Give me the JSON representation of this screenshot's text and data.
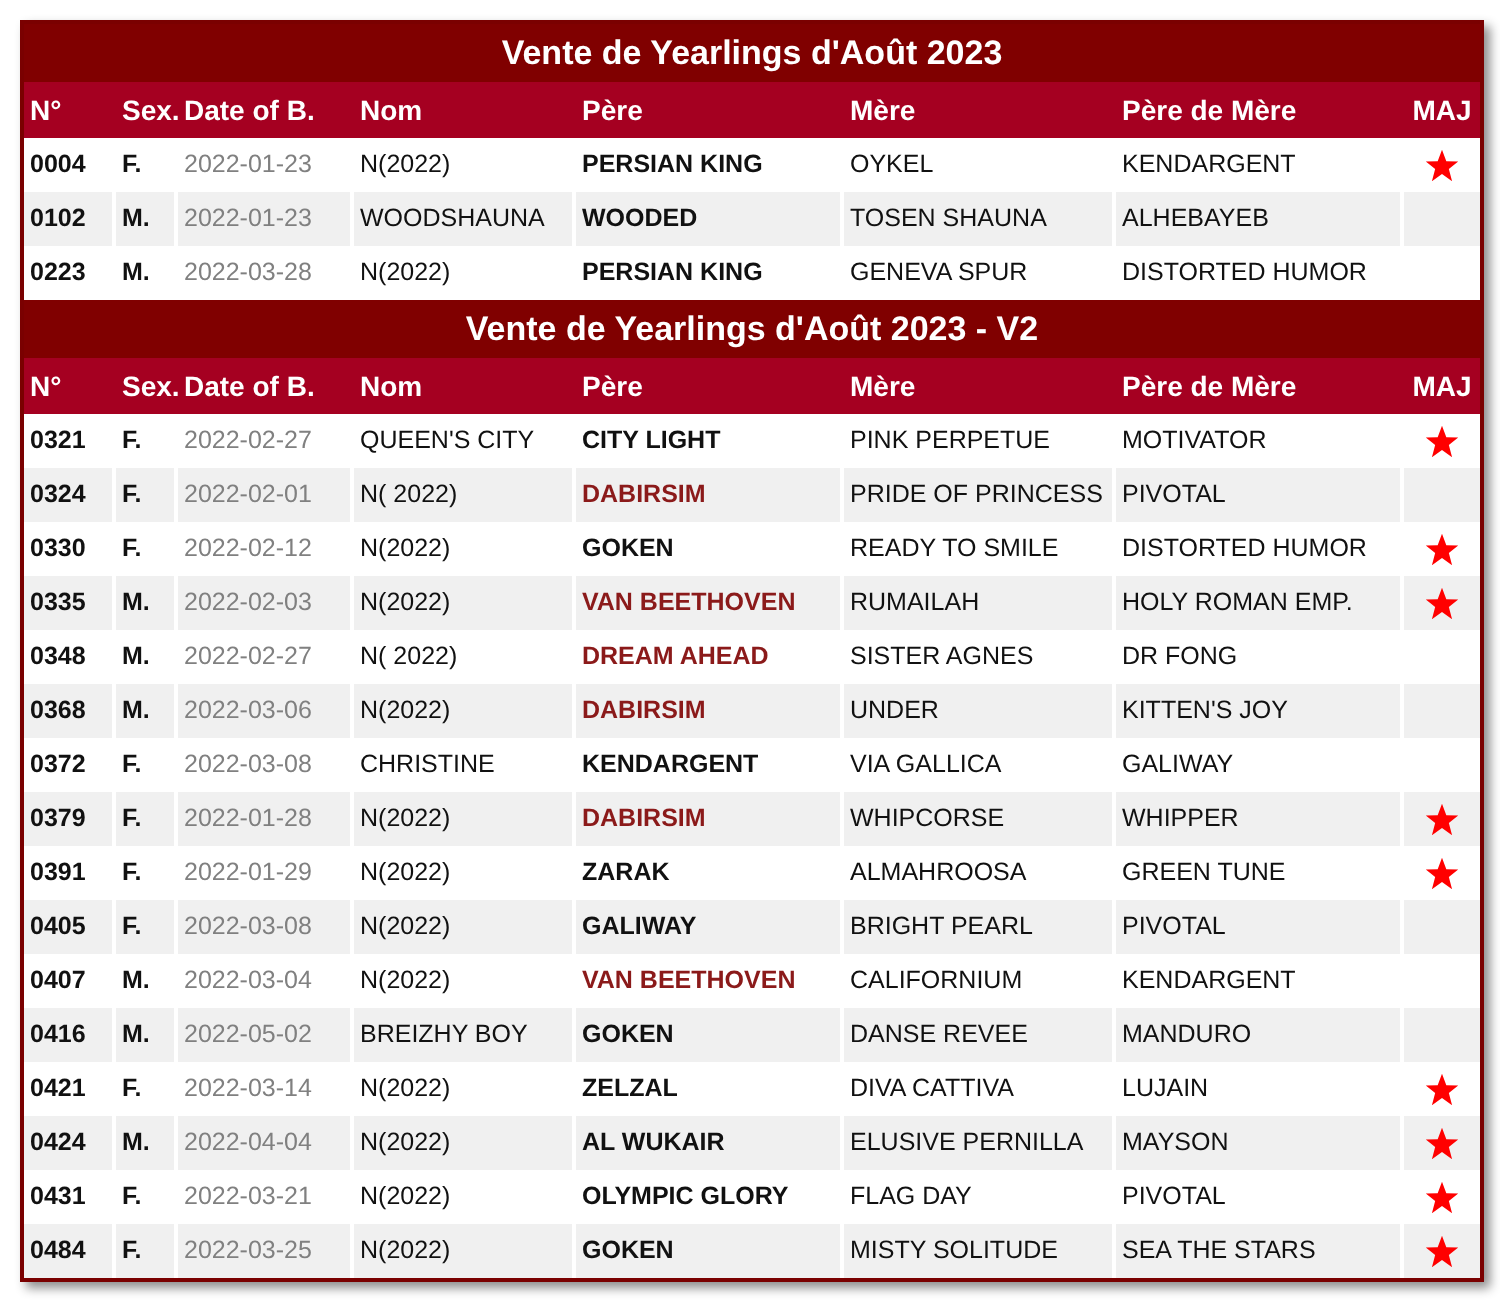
{
  "sections": [
    {
      "title": "Vente de Yearlings d'Août 2023",
      "columns": [
        "N°",
        "Sex.",
        "Date of B.",
        "Nom",
        "Père",
        "Mère",
        "Père de Mère",
        "MAJ"
      ],
      "rows": [
        {
          "number": "0004",
          "sex": "F.",
          "date": "2022-01-23",
          "name": "N(2022)",
          "sire": "PERSIAN KING",
          "sire_highlighted": false,
          "dam": "OYKEL",
          "damsire": "KENDARGENT",
          "updated": true
        },
        {
          "number": "0102",
          "sex": "M.",
          "date": "2022-01-23",
          "name": "WOODSHAUNA",
          "sire": "WOODED",
          "sire_highlighted": false,
          "dam": "TOSEN SHAUNA",
          "damsire": "ALHEBAYEB",
          "updated": false
        },
        {
          "number": "0223",
          "sex": "M.",
          "date": "2022-03-28",
          "name": "N(2022)",
          "sire": "PERSIAN KING",
          "sire_highlighted": false,
          "dam": "GENEVA SPUR",
          "damsire": "DISTORTED HUMOR",
          "updated": false
        }
      ]
    },
    {
      "title": "Vente de Yearlings d'Août 2023 - V2",
      "columns": [
        "N°",
        "Sex.",
        "Date of B.",
        "Nom",
        "Père",
        "Mère",
        "Père de Mère",
        "MAJ"
      ],
      "rows": [
        {
          "number": "0321",
          "sex": "F.",
          "date": "2022-02-27",
          "name": "QUEEN'S CITY",
          "sire": "CITY LIGHT",
          "sire_highlighted": false,
          "dam": "PINK PERPETUE",
          "damsire": "MOTIVATOR",
          "updated": true
        },
        {
          "number": "0324",
          "sex": "F.",
          "date": "2022-02-01",
          "name": "N( 2022)",
          "sire": "DABIRSIM",
          "sire_highlighted": true,
          "dam": "PRIDE OF PRINCESS",
          "damsire": "PIVOTAL",
          "updated": false
        },
        {
          "number": "0330",
          "sex": "F.",
          "date": "2022-02-12",
          "name": "N(2022)",
          "sire": "GOKEN",
          "sire_highlighted": false,
          "dam": "READY TO SMILE",
          "damsire": "DISTORTED HUMOR",
          "updated": true
        },
        {
          "number": "0335",
          "sex": "M.",
          "date": "2022-02-03",
          "name": "N(2022)",
          "sire": "VAN BEETHOVEN",
          "sire_highlighted": true,
          "dam": "RUMAILAH",
          "damsire": "HOLY ROMAN EMP.",
          "updated": true
        },
        {
          "number": "0348",
          "sex": "M.",
          "date": "2022-02-27",
          "name": "N( 2022)",
          "sire": "DREAM AHEAD",
          "sire_highlighted": true,
          "dam": "SISTER AGNES",
          "damsire": "DR FONG",
          "updated": false
        },
        {
          "number": "0368",
          "sex": "M.",
          "date": "2022-03-06",
          "name": "N(2022)",
          "sire": "DABIRSIM",
          "sire_highlighted": true,
          "dam": "UNDER",
          "damsire": "KITTEN'S JOY",
          "updated": false
        },
        {
          "number": "0372",
          "sex": "F.",
          "date": "2022-03-08",
          "name": "CHRISTINE",
          "sire": "KENDARGENT",
          "sire_highlighted": false,
          "dam": "VIA GALLICA",
          "damsire": "GALIWAY",
          "updated": false
        },
        {
          "number": "0379",
          "sex": "F.",
          "date": "2022-01-28",
          "name": "N(2022)",
          "sire": "DABIRSIM",
          "sire_highlighted": true,
          "dam": "WHIPCORSE",
          "damsire": "WHIPPER",
          "updated": true
        },
        {
          "number": "0391",
          "sex": "F.",
          "date": "2022-01-29",
          "name": "N(2022)",
          "sire": "ZARAK",
          "sire_highlighted": false,
          "dam": "ALMAHROOSA",
          "damsire": "GREEN TUNE",
          "updated": true
        },
        {
          "number": "0405",
          "sex": "F.",
          "date": "2022-03-08",
          "name": "N(2022)",
          "sire": "GALIWAY",
          "sire_highlighted": false,
          "dam": "BRIGHT PEARL",
          "damsire": "PIVOTAL",
          "updated": false
        },
        {
          "number": "0407",
          "sex": "M.",
          "date": "2022-03-04",
          "name": "N(2022)",
          "sire": "VAN BEETHOVEN",
          "sire_highlighted": true,
          "dam": "CALIFORNIUM",
          "damsire": "KENDARGENT",
          "updated": false
        },
        {
          "number": "0416",
          "sex": "M.",
          "date": "2022-05-02",
          "name": "BREIZHY BOY",
          "sire": "GOKEN",
          "sire_highlighted": false,
          "dam": "DANSE REVEE",
          "damsire": "MANDURO",
          "updated": false
        },
        {
          "number": "0421",
          "sex": "F.",
          "date": "2022-03-14",
          "name": "N(2022)",
          "sire": "ZELZAL",
          "sire_highlighted": false,
          "dam": "DIVA CATTIVA",
          "damsire": "LUJAIN",
          "updated": true
        },
        {
          "number": "0424",
          "sex": "M.",
          "date": "2022-04-04",
          "name": "N(2022)",
          "sire": "AL WUKAIR",
          "sire_highlighted": false,
          "dam": "ELUSIVE PERNILLA",
          "damsire": "MAYSON",
          "updated": true
        },
        {
          "number": "0431",
          "sex": "F.",
          "date": "2022-03-21",
          "name": "N(2022)",
          "sire": "OLYMPIC GLORY",
          "sire_highlighted": false,
          "dam": "FLAG DAY",
          "damsire": "PIVOTAL",
          "updated": true
        },
        {
          "number": "0484",
          "sex": "F.",
          "date": "2022-03-25",
          "name": "N(2022)",
          "sire": "GOKEN",
          "sire_highlighted": false,
          "dam": "MISTY SOLITUDE",
          "damsire": "SEA THE STARS",
          "updated": true
        }
      ]
    }
  ]
}
